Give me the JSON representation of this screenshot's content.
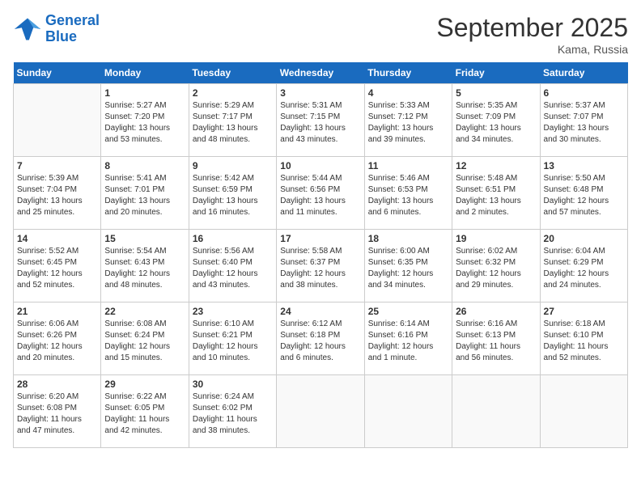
{
  "header": {
    "logo_line1": "General",
    "logo_line2": "Blue",
    "month": "September 2025",
    "location": "Kama, Russia"
  },
  "weekdays": [
    "Sunday",
    "Monday",
    "Tuesday",
    "Wednesday",
    "Thursday",
    "Friday",
    "Saturday"
  ],
  "weeks": [
    [
      {
        "day": "",
        "info": ""
      },
      {
        "day": "1",
        "info": "Sunrise: 5:27 AM\nSunset: 7:20 PM\nDaylight: 13 hours\nand 53 minutes."
      },
      {
        "day": "2",
        "info": "Sunrise: 5:29 AM\nSunset: 7:17 PM\nDaylight: 13 hours\nand 48 minutes."
      },
      {
        "day": "3",
        "info": "Sunrise: 5:31 AM\nSunset: 7:15 PM\nDaylight: 13 hours\nand 43 minutes."
      },
      {
        "day": "4",
        "info": "Sunrise: 5:33 AM\nSunset: 7:12 PM\nDaylight: 13 hours\nand 39 minutes."
      },
      {
        "day": "5",
        "info": "Sunrise: 5:35 AM\nSunset: 7:09 PM\nDaylight: 13 hours\nand 34 minutes."
      },
      {
        "day": "6",
        "info": "Sunrise: 5:37 AM\nSunset: 7:07 PM\nDaylight: 13 hours\nand 30 minutes."
      }
    ],
    [
      {
        "day": "7",
        "info": "Sunrise: 5:39 AM\nSunset: 7:04 PM\nDaylight: 13 hours\nand 25 minutes."
      },
      {
        "day": "8",
        "info": "Sunrise: 5:41 AM\nSunset: 7:01 PM\nDaylight: 13 hours\nand 20 minutes."
      },
      {
        "day": "9",
        "info": "Sunrise: 5:42 AM\nSunset: 6:59 PM\nDaylight: 13 hours\nand 16 minutes."
      },
      {
        "day": "10",
        "info": "Sunrise: 5:44 AM\nSunset: 6:56 PM\nDaylight: 13 hours\nand 11 minutes."
      },
      {
        "day": "11",
        "info": "Sunrise: 5:46 AM\nSunset: 6:53 PM\nDaylight: 13 hours\nand 6 minutes."
      },
      {
        "day": "12",
        "info": "Sunrise: 5:48 AM\nSunset: 6:51 PM\nDaylight: 13 hours\nand 2 minutes."
      },
      {
        "day": "13",
        "info": "Sunrise: 5:50 AM\nSunset: 6:48 PM\nDaylight: 12 hours\nand 57 minutes."
      }
    ],
    [
      {
        "day": "14",
        "info": "Sunrise: 5:52 AM\nSunset: 6:45 PM\nDaylight: 12 hours\nand 52 minutes."
      },
      {
        "day": "15",
        "info": "Sunrise: 5:54 AM\nSunset: 6:43 PM\nDaylight: 12 hours\nand 48 minutes."
      },
      {
        "day": "16",
        "info": "Sunrise: 5:56 AM\nSunset: 6:40 PM\nDaylight: 12 hours\nand 43 minutes."
      },
      {
        "day": "17",
        "info": "Sunrise: 5:58 AM\nSunset: 6:37 PM\nDaylight: 12 hours\nand 38 minutes."
      },
      {
        "day": "18",
        "info": "Sunrise: 6:00 AM\nSunset: 6:35 PM\nDaylight: 12 hours\nand 34 minutes."
      },
      {
        "day": "19",
        "info": "Sunrise: 6:02 AM\nSunset: 6:32 PM\nDaylight: 12 hours\nand 29 minutes."
      },
      {
        "day": "20",
        "info": "Sunrise: 6:04 AM\nSunset: 6:29 PM\nDaylight: 12 hours\nand 24 minutes."
      }
    ],
    [
      {
        "day": "21",
        "info": "Sunrise: 6:06 AM\nSunset: 6:26 PM\nDaylight: 12 hours\nand 20 minutes."
      },
      {
        "day": "22",
        "info": "Sunrise: 6:08 AM\nSunset: 6:24 PM\nDaylight: 12 hours\nand 15 minutes."
      },
      {
        "day": "23",
        "info": "Sunrise: 6:10 AM\nSunset: 6:21 PM\nDaylight: 12 hours\nand 10 minutes."
      },
      {
        "day": "24",
        "info": "Sunrise: 6:12 AM\nSunset: 6:18 PM\nDaylight: 12 hours\nand 6 minutes."
      },
      {
        "day": "25",
        "info": "Sunrise: 6:14 AM\nSunset: 6:16 PM\nDaylight: 12 hours\nand 1 minute."
      },
      {
        "day": "26",
        "info": "Sunrise: 6:16 AM\nSunset: 6:13 PM\nDaylight: 11 hours\nand 56 minutes."
      },
      {
        "day": "27",
        "info": "Sunrise: 6:18 AM\nSunset: 6:10 PM\nDaylight: 11 hours\nand 52 minutes."
      }
    ],
    [
      {
        "day": "28",
        "info": "Sunrise: 6:20 AM\nSunset: 6:08 PM\nDaylight: 11 hours\nand 47 minutes."
      },
      {
        "day": "29",
        "info": "Sunrise: 6:22 AM\nSunset: 6:05 PM\nDaylight: 11 hours\nand 42 minutes."
      },
      {
        "day": "30",
        "info": "Sunrise: 6:24 AM\nSunset: 6:02 PM\nDaylight: 11 hours\nand 38 minutes."
      },
      {
        "day": "",
        "info": ""
      },
      {
        "day": "",
        "info": ""
      },
      {
        "day": "",
        "info": ""
      },
      {
        "day": "",
        "info": ""
      }
    ]
  ]
}
